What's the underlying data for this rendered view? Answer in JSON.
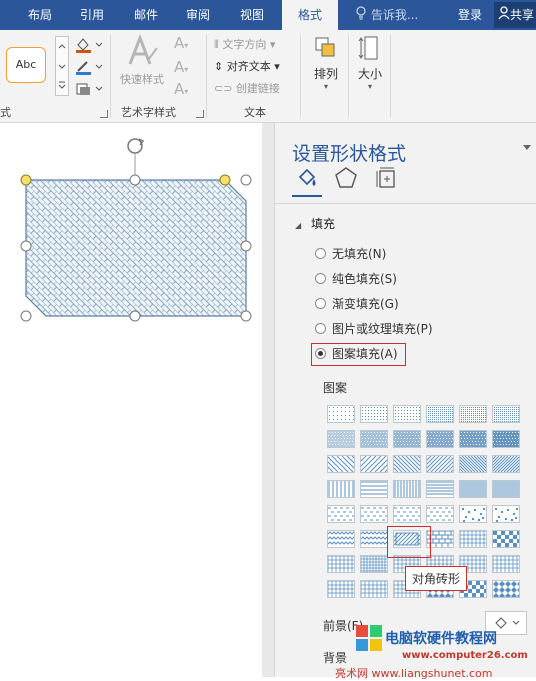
{
  "tabs": [
    {
      "label": "布局"
    },
    {
      "label": "引用"
    },
    {
      "label": "邮件"
    },
    {
      "label": "审阅"
    },
    {
      "label": "视图"
    },
    {
      "label": "格式",
      "active": true
    }
  ],
  "tell_me": "告诉我...",
  "login": "登录",
  "share": "共享",
  "ribbon": {
    "shape_style_sample": "Abc",
    "left_group_label": "式",
    "quick_styles": "快速样式",
    "wordart_group": "艺术字样式",
    "text_direction": "文字方向",
    "align_text": "对齐文本",
    "create_link": "创建链接",
    "text_group": "文本",
    "arrange": "排列",
    "size": "大小"
  },
  "pane": {
    "title": "设置形状格式",
    "fill_section": "填充",
    "fill_options": [
      {
        "label": "无填充(N)",
        "selected": false
      },
      {
        "label": "纯色填充(S)",
        "selected": false
      },
      {
        "label": "渐变填充(G)",
        "selected": false
      },
      {
        "label": "图片或纹理填充(P)",
        "selected": false
      },
      {
        "label": "图案填充(A)",
        "selected": true
      }
    ],
    "pattern_label": "图案",
    "tooltip": "对角砖形",
    "foreground_label": "前景(F)",
    "background_label": "背景"
  },
  "watermark": {
    "title": "电脑软硬件教程网",
    "site": "www.computer26.com",
    "site2": "亮术网 www.liangshunet.com"
  },
  "colors": {
    "accent": "#2b579a",
    "highlight_border": "#c9302c",
    "pattern_blue": "#5b8fbf"
  }
}
